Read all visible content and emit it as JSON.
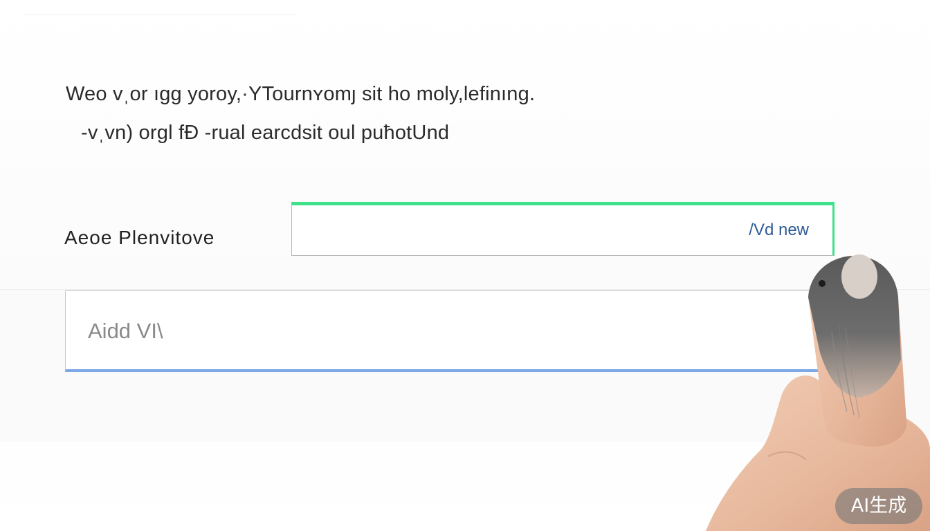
{
  "description": {
    "line1": "Weo vˌor ıgg yoroy,·YTournʏomȷ sit ho moly,lefinıng.",
    "line2": "-vˌvn) orgl fÐ -rual earcdsit oul puħotUnd"
  },
  "field": {
    "label": "Aeoe Plenvitove",
    "value": "/Vd new"
  },
  "add_box": {
    "text": "Aidd VI\\"
  },
  "badge": {
    "text": "AI生成"
  },
  "colors": {
    "focus_border": "#3fe08a",
    "value_text": "#2d5a94",
    "add_underline": "#7fa8e6"
  },
  "icons": {
    "hand": "finger-pointer-icon"
  }
}
